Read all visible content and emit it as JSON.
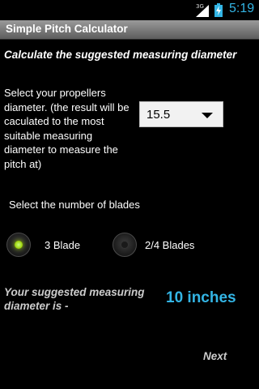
{
  "status_bar": {
    "network": "3G",
    "time": "5:19",
    "accent_color": "#33b5e5"
  },
  "app": {
    "title": "Simple Pitch Calculator"
  },
  "main": {
    "heading": "Calculate the suggested measuring diameter",
    "propeller_label": "Select your propellers diameter. (the result will be caculated to the most suitable measuring diameter to measure the pitch at)",
    "diameter_selected": "15.5",
    "blades_label": "Select the number of blades",
    "blade_options": [
      {
        "label": "3 Blade",
        "selected": true
      },
      {
        "label": "2/4 Blades",
        "selected": false
      }
    ],
    "result_label": "Your suggested measuring diameter is -",
    "result_value": "10 inches",
    "next_label": "Next"
  }
}
